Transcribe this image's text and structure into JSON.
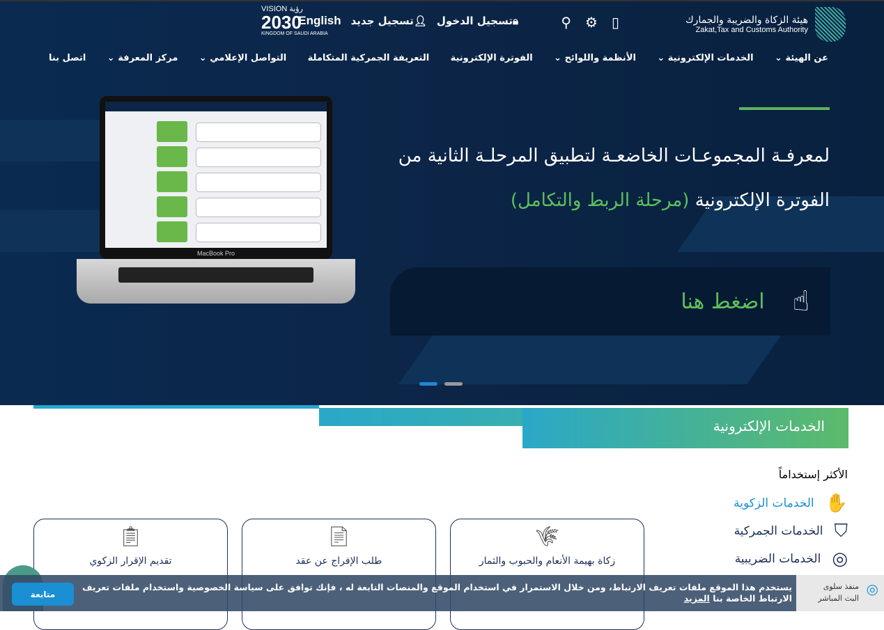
{
  "header": {
    "org_name_ar": "هيئة الزكاة والضريبة والجمارك",
    "org_name_en": "Zakat,Tax and Customs Authority",
    "vision_logo": "VISION 2030 رؤية المملكة العربية السعودية KINGDOM OF SAUDI ARABIA",
    "login": "تسجيل الدخول",
    "register": "تسجيل جديد",
    "language": "English",
    "icons": [
      "mobile-icon",
      "settings-icon",
      "search-icon",
      "lock-icon",
      "user-plus-icon"
    ]
  },
  "nav": [
    {
      "label": "عن الهيئة",
      "dropdown": true
    },
    {
      "label": "الخدمات الإلكترونية",
      "dropdown": true
    },
    {
      "label": "الأنظمة واللوائح",
      "dropdown": true
    },
    {
      "label": "الفوترة الإلكترونية",
      "dropdown": false
    },
    {
      "label": "التعريفة الجمركية المتكاملة",
      "dropdown": false
    },
    {
      "label": "التواصل الإعلامي",
      "dropdown": true
    },
    {
      "label": "مركز المعرفة",
      "dropdown": true
    },
    {
      "label": "اتصل بنا",
      "dropdown": false
    }
  ],
  "hero": {
    "line1": "لمعرفـة المجموعـات الخاضعـة لتطبيق المرحلـة الثانية من",
    "line2": "الفوترة الإلكترونية",
    "line2_highlight": "(مرحلة الربط والتكامل)",
    "cta": "اضغط هنا",
    "slides": 2,
    "active_slide": 1,
    "laptop_brand": "MacBook Pro"
  },
  "services": {
    "title": "الخدمات الإلكترونية",
    "most_used": "الأكثر إستخداماً",
    "categories": [
      {
        "label": "الخدمات الزكوية",
        "active": true
      },
      {
        "label": "الخدمات الجمركية",
        "active": false
      },
      {
        "label": "الخدمات الضريبية",
        "active": false
      }
    ],
    "cards": [
      {
        "title": "زكاة بهيمة الأنعام والحبوب والثمار"
      },
      {
        "title": "طلب الإفراج عن عقد"
      },
      {
        "title": "تقديم الإقرار الزكوي"
      }
    ]
  },
  "live": {
    "line1": "منفذ سلوى",
    "line2": "البث المباشر"
  },
  "cookie": {
    "text": "يستخدم هذا الموقع ملفات تعريف الارتباط، ومن خلال الاستمرار في استخدام الموقع والمنصات التابعة له ، فإنك توافق على سياسة الخصوصية واستخدام ملفات تعريف الارتباط الخاصة بنا",
    "more": "المزيد",
    "accept": "متابعة"
  },
  "colors": {
    "navy": "#0c2547",
    "green": "#5cc15c",
    "blue": "#1a8fd4"
  }
}
